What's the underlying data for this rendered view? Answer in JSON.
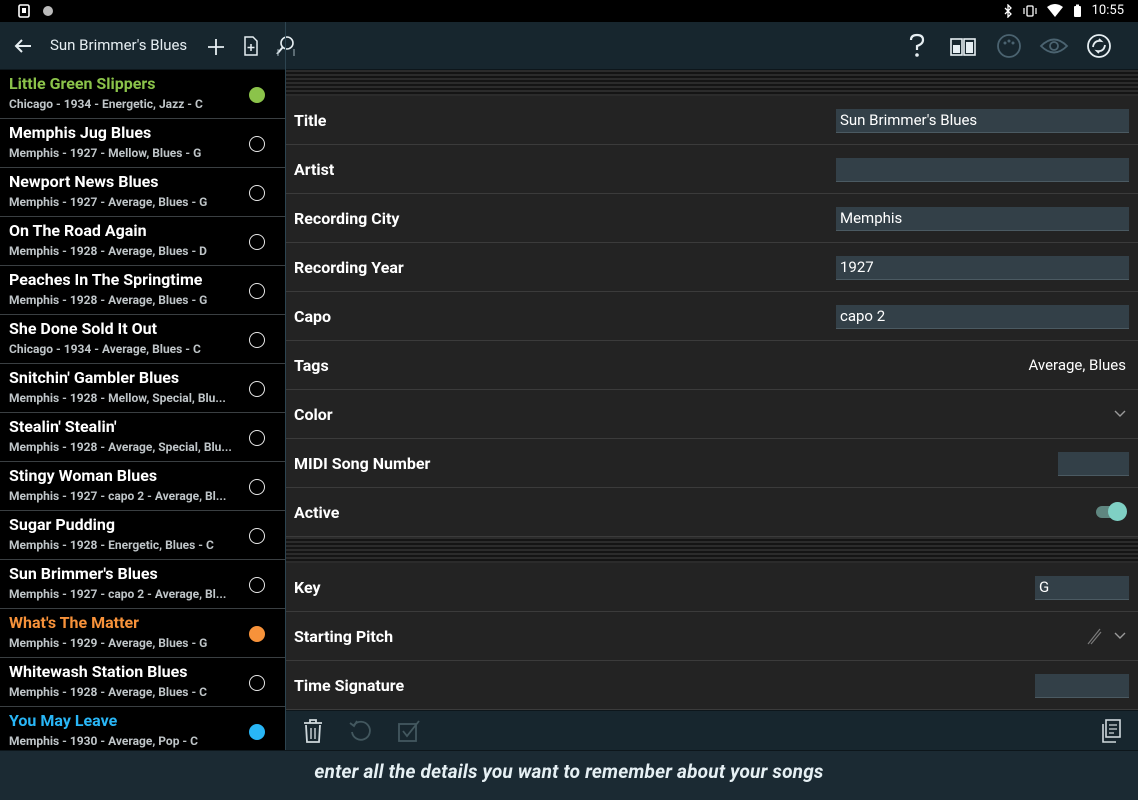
{
  "statusbar": {
    "time": "10:55"
  },
  "appbar": {
    "title": "Sun Brimmer's Blues"
  },
  "songs": [
    {
      "title": "Little Green Slippers",
      "sub": "Chicago - 1934 - Energetic, Jazz - C",
      "title_color": "#8bc34a",
      "dot": "#8bc34a"
    },
    {
      "title": "Memphis Jug Blues",
      "sub": "Memphis - 1927 - Mellow, Blues - G",
      "title_color": "#ffffff",
      "dot": ""
    },
    {
      "title": "Newport News Blues",
      "sub": "Memphis - 1927 - Average, Blues - G",
      "title_color": "#ffffff",
      "dot": ""
    },
    {
      "title": "On The Road Again",
      "sub": "Memphis - 1928 - Average, Blues - D",
      "title_color": "#ffffff",
      "dot": ""
    },
    {
      "title": "Peaches In The Springtime",
      "sub": "Memphis - 1928 - Average, Blues - G",
      "title_color": "#ffffff",
      "dot": ""
    },
    {
      "title": "She Done Sold It Out",
      "sub": "Chicago - 1934 - Average, Blues - C",
      "title_color": "#ffffff",
      "dot": ""
    },
    {
      "title": "Snitchin' Gambler Blues",
      "sub": "Memphis - 1928 - Mellow, Special, Blu...",
      "title_color": "#ffffff",
      "dot": ""
    },
    {
      "title": "Stealin' Stealin'",
      "sub": "Memphis - 1928 - Average, Special, Blu...",
      "title_color": "#ffffff",
      "dot": ""
    },
    {
      "title": "Stingy Woman Blues",
      "sub": "Memphis - 1927 - capo 2 - Average, Bl...",
      "title_color": "#ffffff",
      "dot": ""
    },
    {
      "title": "Sugar Pudding",
      "sub": "Memphis - 1928 - Energetic, Blues - C",
      "title_color": "#ffffff",
      "dot": ""
    },
    {
      "title": "Sun Brimmer's Blues",
      "sub": "Memphis - 1927 - capo 2 - Average, Bl...",
      "title_color": "#ffffff",
      "dot": ""
    },
    {
      "title": "What's The Matter",
      "sub": "Memphis - 1929 - Average, Blues - G",
      "title_color": "#f7923a",
      "dot": "#f7923a"
    },
    {
      "title": "Whitewash Station Blues",
      "sub": "Memphis - 1928 - Average, Blues - C",
      "title_color": "#ffffff",
      "dot": ""
    },
    {
      "title": "You May Leave",
      "sub": "Memphis - 1930 - Average, Pop - C",
      "title_color": "#29b6f6",
      "dot": "#29b6f6"
    }
  ],
  "detail": {
    "title_label": "Title",
    "title_value": "Sun Brimmer's Blues",
    "artist_label": "Artist",
    "artist_value": "",
    "city_label": "Recording City",
    "city_value": "Memphis",
    "year_label": "Recording Year",
    "year_value": "1927",
    "capo_label": "Capo",
    "capo_value": "capo 2",
    "tags_label": "Tags",
    "tags_value": "Average, Blues",
    "color_label": "Color",
    "midi_label": "MIDI Song Number",
    "midi_value": "",
    "active_label": "Active",
    "active_on": true,
    "key_label": "Key",
    "key_value": "G",
    "pitch_label": "Starting Pitch",
    "timesig_label": "Time Signature",
    "timesig_value": ""
  },
  "caption": "enter all the details you want to remember about your songs",
  "colors": {
    "accent": "#7fd0c4",
    "appbar": "#17262e",
    "list_bg": "#000000",
    "detail_bg": "#232323",
    "field_bg": "#334048"
  },
  "icons": [
    "back-icon",
    "add-icon",
    "new-document-icon",
    "search-icon",
    "help-icon",
    "layout-icon",
    "metronome-icon",
    "eye-icon",
    "sync-icon",
    "trash-icon",
    "undo-icon",
    "checkbox-icon",
    "copy-icon"
  ]
}
